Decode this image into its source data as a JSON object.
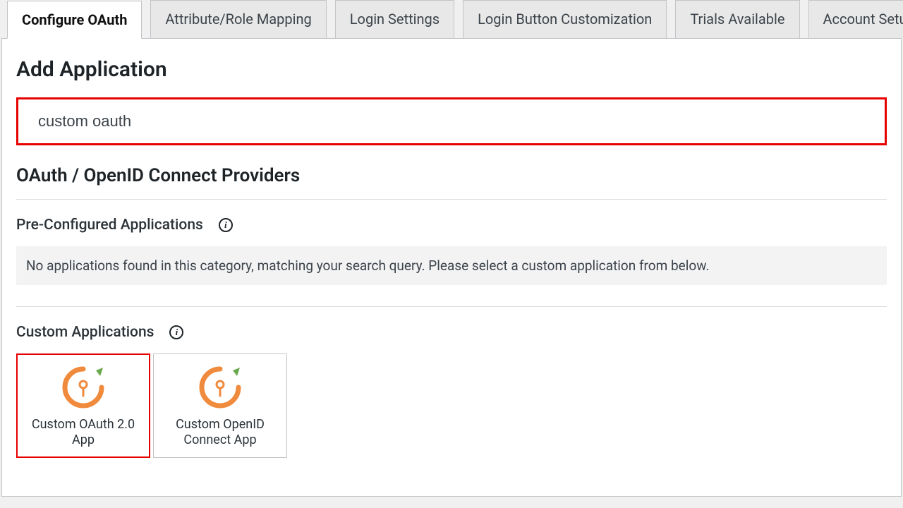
{
  "tabs": [
    {
      "label": "Configure OAuth",
      "active": true
    },
    {
      "label": "Attribute/Role Mapping",
      "active": false
    },
    {
      "label": "Login Settings",
      "active": false
    },
    {
      "label": "Login Button Customization",
      "active": false
    },
    {
      "label": "Trials Available",
      "active": false
    },
    {
      "label": "Account Setu",
      "active": false
    }
  ],
  "page_title": "Add Application",
  "search_value": "custom oauth",
  "providers_title": "OAuth / OpenID Connect Providers",
  "preconfigured_heading": "Pre-Configured Applications",
  "no_results_text": "No applications found in this category, matching your search query. Please select a custom application from below.",
  "custom_heading": "Custom Applications",
  "cards": [
    {
      "label": "Custom OAuth 2.0 App",
      "selected": true
    },
    {
      "label": "Custom OpenID Connect App",
      "selected": false
    }
  ],
  "info_glyph": "i"
}
